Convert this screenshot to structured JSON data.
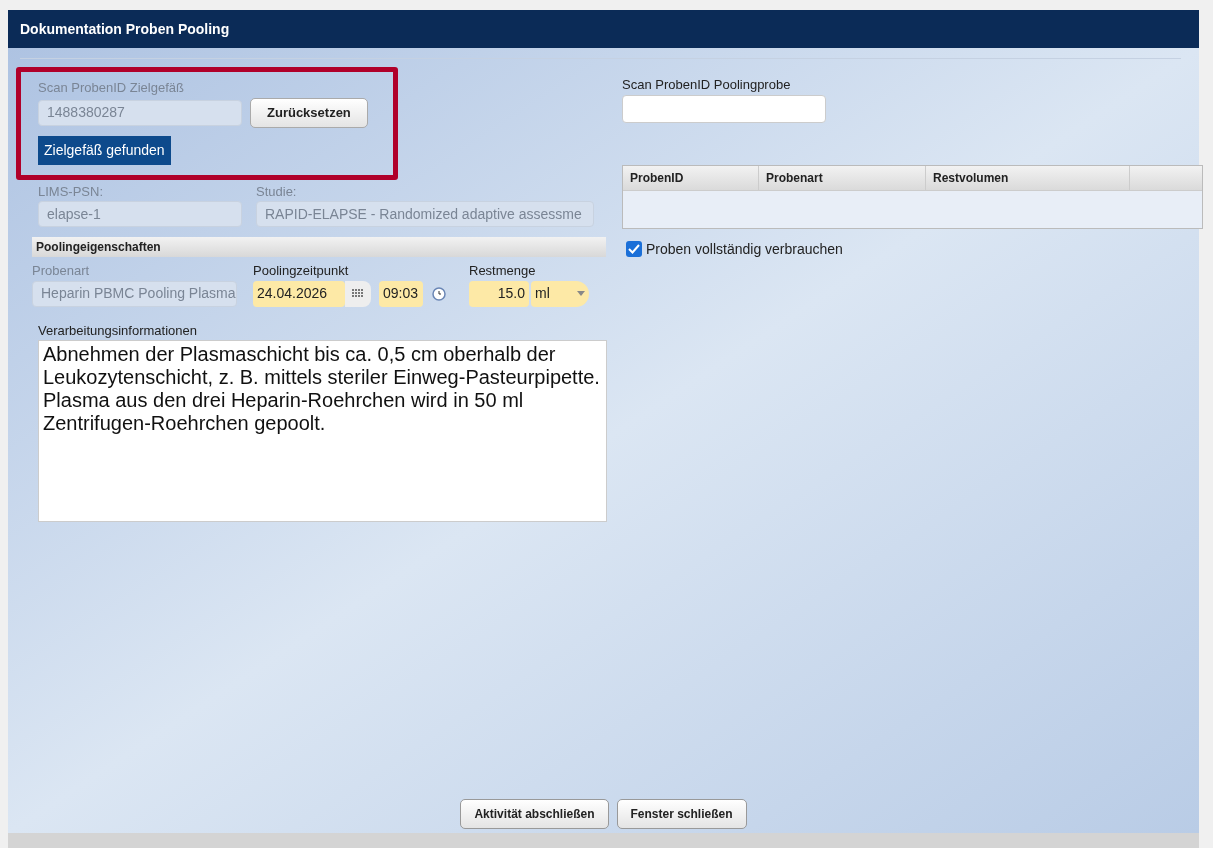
{
  "window": {
    "title": "Dokumentation Proben Pooling"
  },
  "target_scan": {
    "label": "Scan ProbenID Zielgefäß",
    "value": "1488380287",
    "reset_button": "Zurücksetzen",
    "status": "Zielgefäß gefunden",
    "highlighted": true
  },
  "lims_psn": {
    "label": "LIMS-PSN:",
    "value": "elapse-1"
  },
  "study": {
    "label": "Studie:",
    "value": "RAPID-ELAPSE - Randomized adaptive assessme"
  },
  "pooling_properties": {
    "title": "Poolingeigenschaften",
    "sample_type": {
      "label": "Probenart",
      "value": "Heparin PBMC Pooling Plasma"
    },
    "pooling_time": {
      "label": "Poolingzeitpunkt",
      "date": "24.04.2026",
      "time": "09:03"
    },
    "remaining": {
      "label": "Restmenge",
      "value": "15.0",
      "unit": "ml"
    }
  },
  "processing_info": {
    "label": "Verarbeitungsinformationen",
    "value": "Abnehmen der Plasmaschicht bis ca. 0,5 cm oberhalb der Leukozytenschicht, z. B. mittels steriler Einweg-Pasteurpipette. Plasma aus den drei Heparin-Roehrchen wird in 50 ml Zentrifugen-Roehrchen gepoolt."
  },
  "pool_scan": {
    "label": "Scan ProbenID Poolingprobe"
  },
  "table": {
    "columns": [
      "ProbenID",
      "Probenart",
      "Restvolumen"
    ]
  },
  "consume_all": {
    "label": "Proben vollständig verbrauchen",
    "checked": true
  },
  "buttons": [
    "Aktivität abschließen",
    "Fenster schließen"
  ]
}
